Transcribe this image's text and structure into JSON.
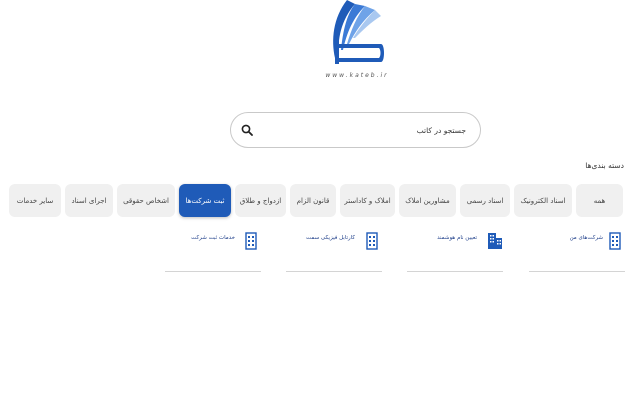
{
  "logo": {
    "url_text": "www.kateb.ir"
  },
  "search": {
    "placeholder": "جستجو در کاتب",
    "icon": "search-icon"
  },
  "categories": {
    "title": "دسته بندی‌ها",
    "items": [
      {
        "label": "همه",
        "active": false
      },
      {
        "label": "اسناد الکترونیک",
        "active": false
      },
      {
        "label": "اسناد رسمی",
        "active": false
      },
      {
        "label": "مشاورین املاک",
        "active": false
      },
      {
        "label": "املاک و کاداستر",
        "active": false
      },
      {
        "label": "قانون الزام",
        "active": false
      },
      {
        "label": "ازدواج و طلاق",
        "active": false
      },
      {
        "label": "ثبت شرکت‌ها",
        "active": true
      },
      {
        "label": "اشخاص حقوقی",
        "active": false
      },
      {
        "label": "اجرای اسناد",
        "active": false
      },
      {
        "label": "سایر خدمات",
        "active": false
      }
    ]
  },
  "services": [
    {
      "label": "شرکت‌های من",
      "icon": "building-icon"
    },
    {
      "label": "تعیین نام هوشمند",
      "icon": "buildings-icon"
    },
    {
      "label": "کارتابل فیزیکی سمت",
      "icon": "building-icon"
    },
    {
      "label": "خدمات ثبت شرکت",
      "icon": "building-icon"
    }
  ],
  "colors": {
    "accent": "#1f5bb8",
    "pill_bg": "#f0f0f0",
    "link": "#1f3f8a"
  }
}
